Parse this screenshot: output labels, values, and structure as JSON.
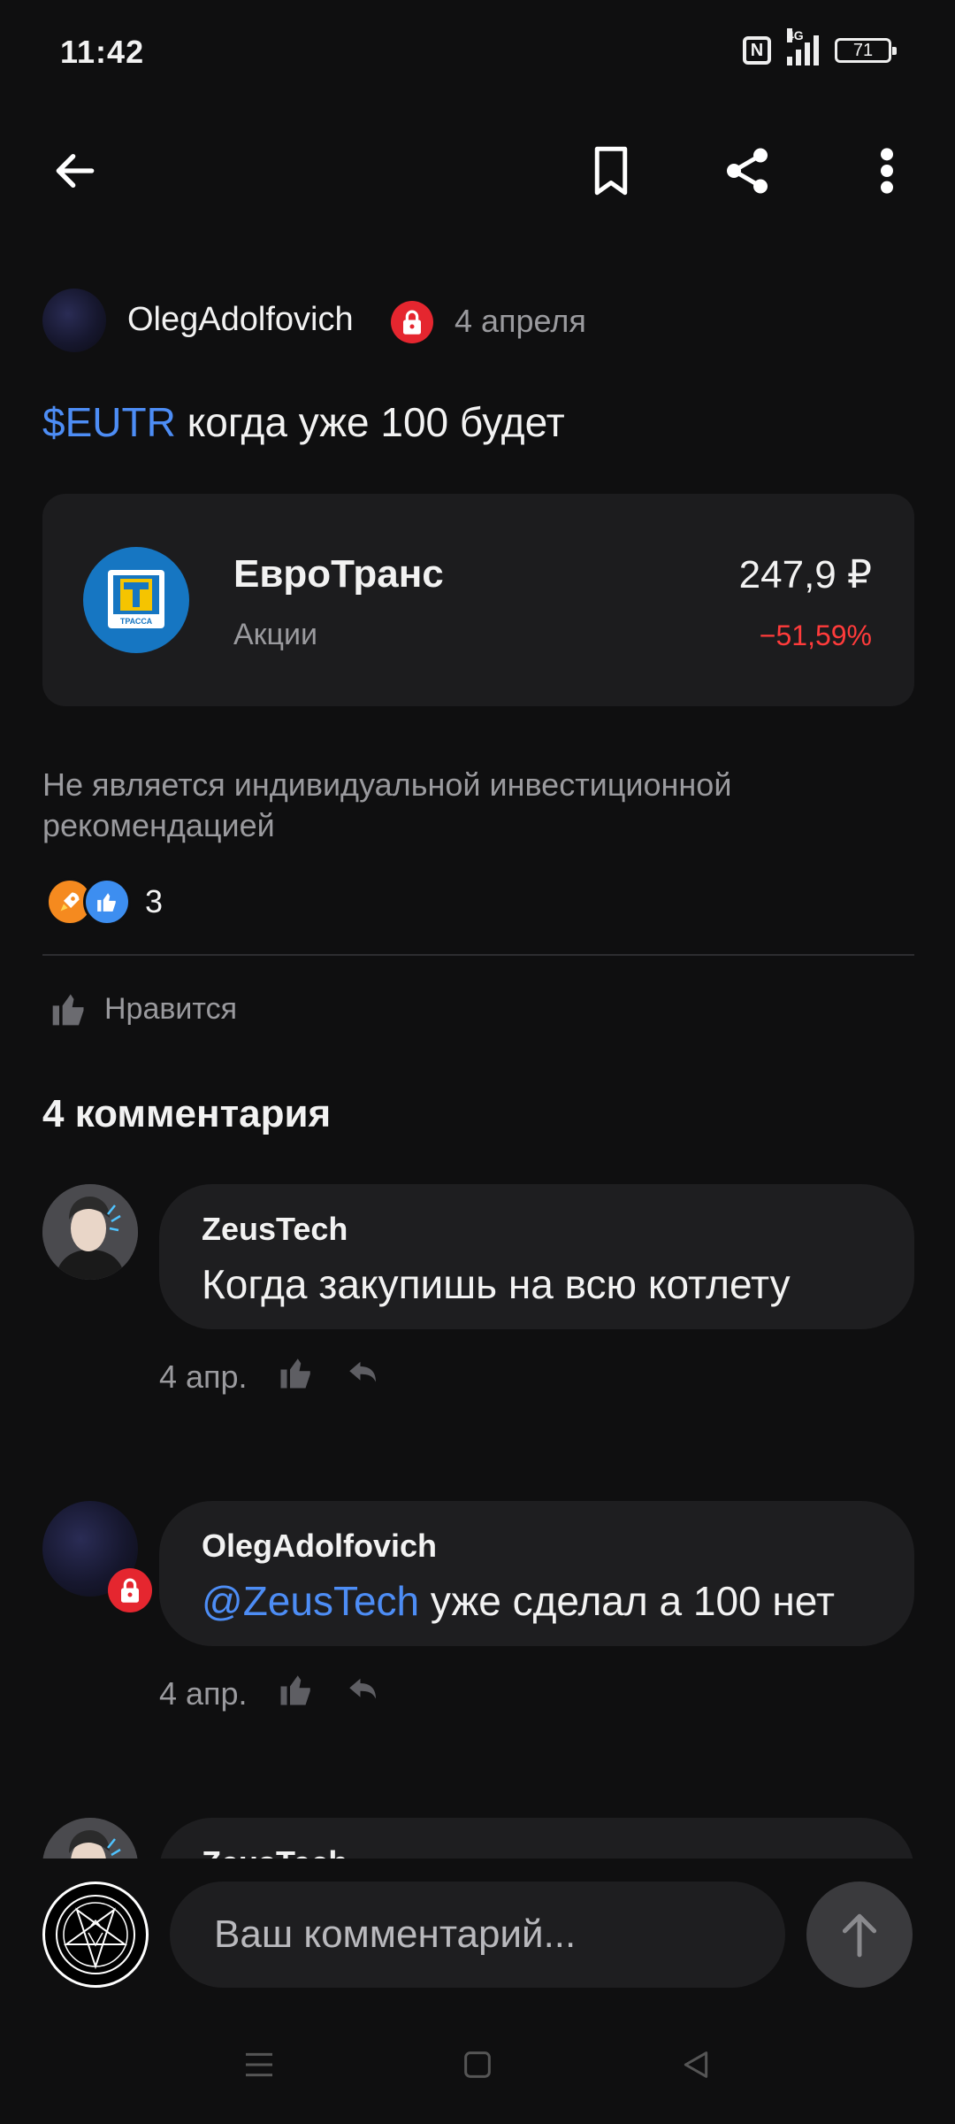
{
  "status_bar": {
    "time": "11:42",
    "network": "4G",
    "battery": "71"
  },
  "post": {
    "author": "OlegAdolfovich",
    "date": "4 апреля",
    "ticker": "$EUTR",
    "text": " когда уже 100 будет",
    "stock": {
      "name": "ЕвроТранс",
      "type": "Акции",
      "price": "247,9 ₽",
      "change": "−51,59%",
      "logo_text": "ТРАССА"
    },
    "disclaimer": "Не является индивидуальной инвестиционной рекомендацией",
    "reactions_count": "3",
    "like_label": "Нравится"
  },
  "comments": {
    "title": "4 комментария",
    "items": [
      {
        "author": "ZeusTech",
        "text": "Когда закупишь на всю котлету",
        "date": "4 апр."
      },
      {
        "author": "OlegAdolfovich",
        "mention": "@ZeusTech",
        "text": " уже сделал а 100 нет",
        "date": "4 апр."
      },
      {
        "author": "ZeusTech"
      }
    ]
  },
  "composer": {
    "placeholder": "Ваш комментарий..."
  },
  "colors": {
    "accent": "#4d8df5",
    "negative": "#ff3b3b",
    "lock_badge": "#e5262f"
  }
}
